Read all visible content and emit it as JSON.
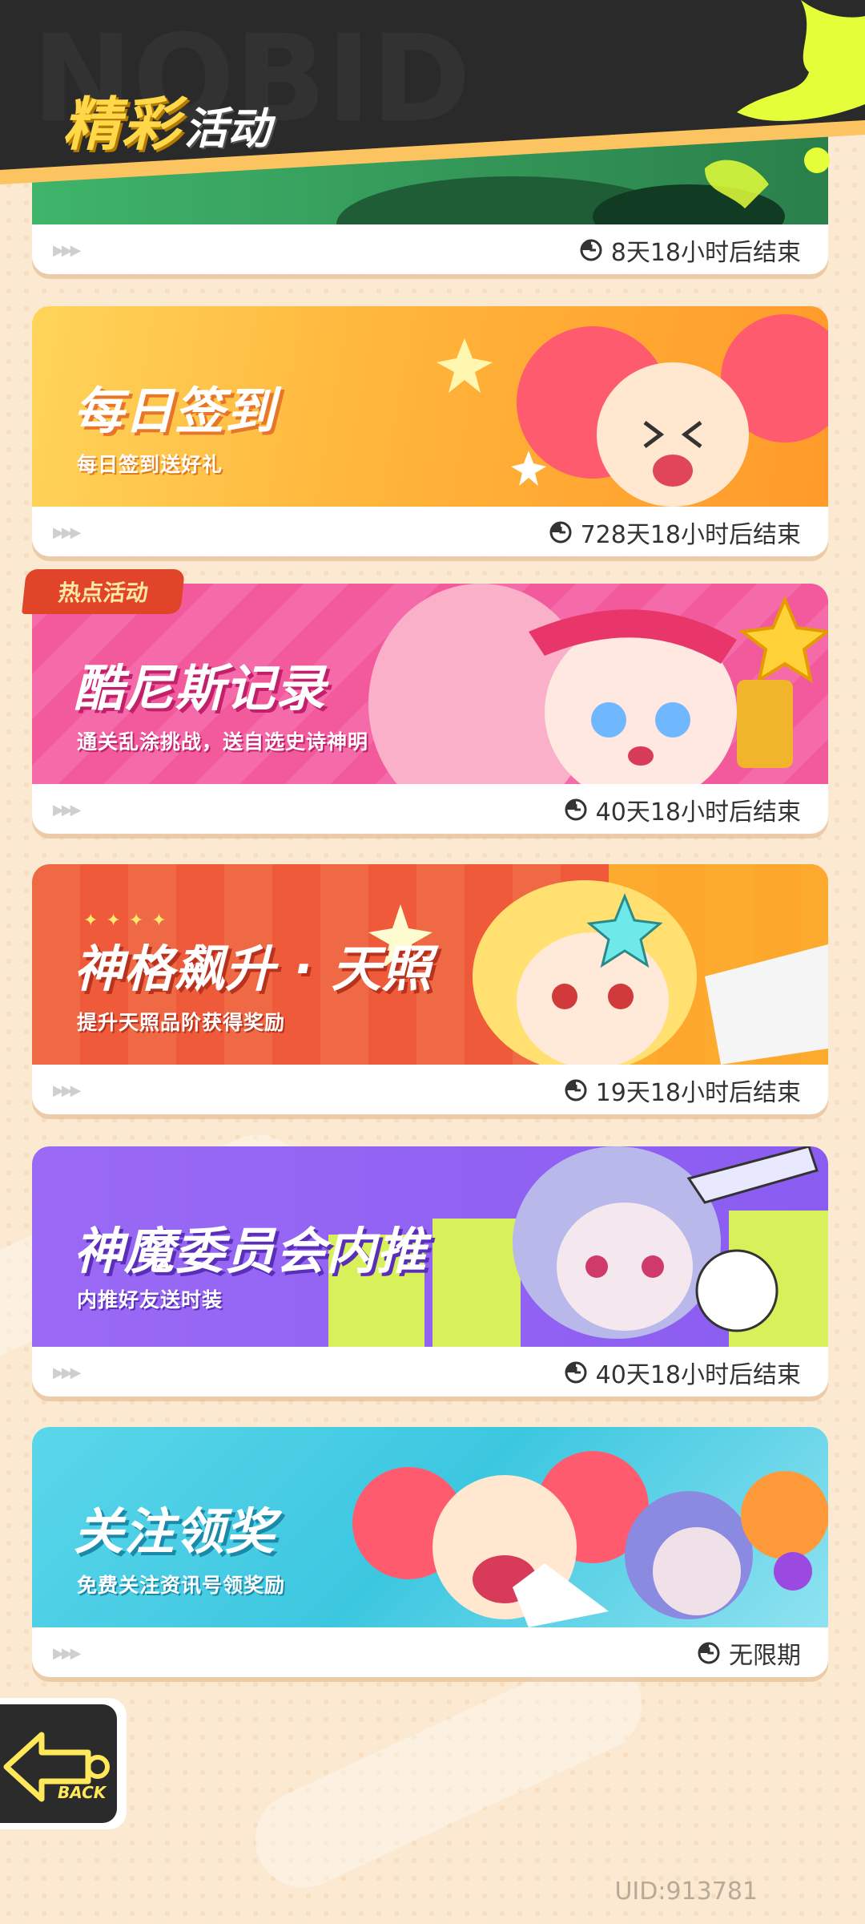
{
  "header": {
    "title_part1": "精彩",
    "title_part2": "活动"
  },
  "events": [
    {
      "title": "",
      "subtitle": "",
      "timer": "8天18小时后结束",
      "icon": "clock-icon"
    },
    {
      "title": "每日签到",
      "subtitle": "每日签到送好礼",
      "timer": "728天18小时后结束",
      "icon": "clock-icon"
    },
    {
      "title": "酷尼斯记录",
      "subtitle": "通关乱涂挑战，送自选史诗神明",
      "timer": "40天18小时后结束",
      "tag": "热点活动",
      "icon": "clock-icon"
    },
    {
      "title": "神格飙升 · 天照",
      "subtitle": "提升天照品阶获得奖励",
      "timer": "19天18小时后结束",
      "icon": "clock-icon"
    },
    {
      "title": "神魔委员会内推",
      "subtitle": "内推好友送时装",
      "timer": "40天18小时后结束",
      "icon": "clock-icon"
    },
    {
      "title": "关注领奖",
      "subtitle": "免费关注资讯号领奖励",
      "timer": "无限期",
      "icon": "clock-icon"
    }
  ],
  "back_button": {
    "label": "BACK",
    "icon": "arrow-left-icon"
  },
  "uid": "UID:913781",
  "colors": {
    "header_dark": "#2a2a2a",
    "header_orange": "#f7b23b",
    "accent_yellow": "#e4ff3a",
    "checkin_orange": "#ffb43a",
    "record_pink": "#f25a9c",
    "ascend_red": "#ef5a3a",
    "committee_purple": "#8a5cf0",
    "follow_cyan": "#3cc7e0",
    "hot_tag_red": "#e0452a"
  }
}
